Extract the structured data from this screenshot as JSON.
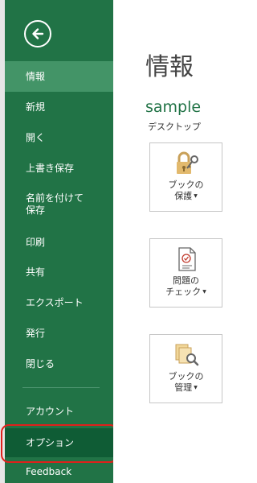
{
  "nav": {
    "info": "情報",
    "new": "新規",
    "open": "開く",
    "save": "上書き保存",
    "save_as_line1": "名前を付けて",
    "save_as_line2": "保存",
    "print": "印刷",
    "share": "共有",
    "export": "エクスポート",
    "publish": "発行",
    "close": "閉じる",
    "account": "アカウント",
    "options": "オプション",
    "feedback": "Feedback"
  },
  "main": {
    "title": "情報",
    "doc_name": "sample",
    "location": "デスクトップ",
    "protect": {
      "line1": "ブックの",
      "line2": "保護"
    },
    "check": {
      "line1": "問題の",
      "line2": "チェック"
    },
    "manage": {
      "line1": "ブックの",
      "line2": "管理"
    },
    "caret": "▼"
  },
  "colors": {
    "sidebar": "#217346",
    "active": "#439467",
    "selected": "#0f5c35",
    "highlight": "#e0201b",
    "doc_name": "#217346"
  }
}
